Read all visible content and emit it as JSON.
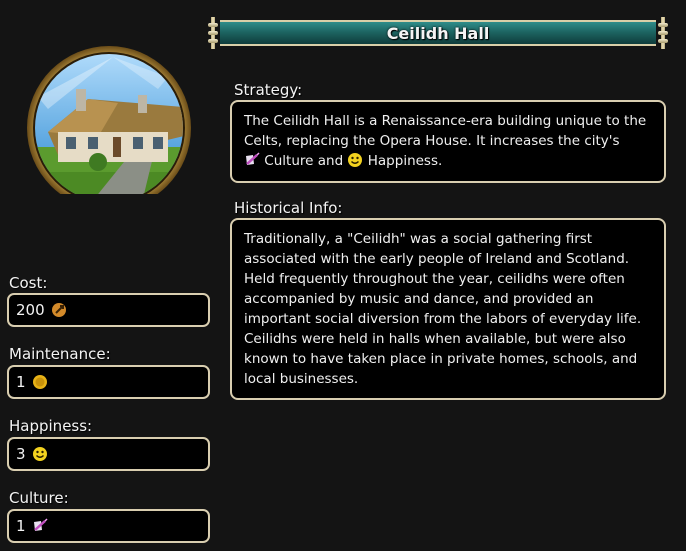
{
  "title": "Ceilidh Hall",
  "stats": [
    {
      "label": "Cost:",
      "value": "200",
      "icon": "production-icon"
    },
    {
      "label": "Maintenance:",
      "value": "1",
      "icon": "gold-icon"
    },
    {
      "label": "Happiness:",
      "value": "3",
      "icon": "happiness-icon"
    },
    {
      "label": "Culture:",
      "value": "1",
      "icon": "culture-icon"
    }
  ],
  "strategy": {
    "heading": "Strategy:",
    "text_1": "The Ceilidh Hall is a Renaissance-era building unique to the Celts, replacing the Opera House. It increases the city's",
    "culture_word": "Culture",
    "and_word": "and",
    "happiness_word": "Happiness."
  },
  "history": {
    "heading": "Historical Info:",
    "text": "Traditionally, a \"Ceilidh\" was a social gathering first associated with the early people of Ireland and Scotland. Held frequently throughout the year, ceilidhs were often accompanied by music and dance, and provided an important social diversion from the labors of everyday life. Ceilidhs were held in halls when available, but were also known to have taken place in private homes, schools, and local businesses."
  },
  "colors": {
    "banner": "#1d6562",
    "border": "#d9ceb0",
    "panel": "#000000"
  }
}
